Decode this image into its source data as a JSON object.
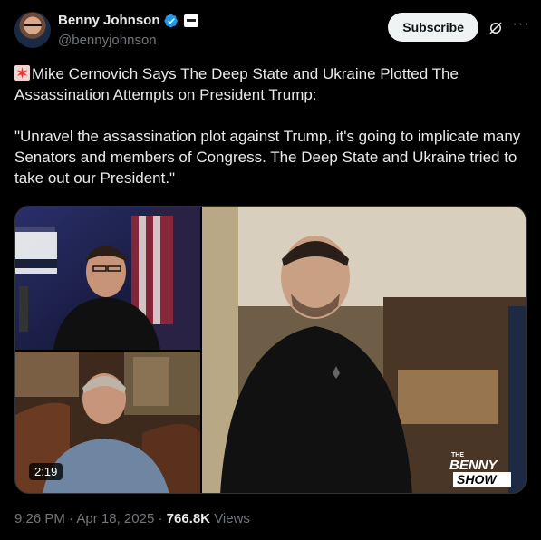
{
  "author": {
    "name": "Benny Johnson",
    "handle": "@bennyjohnson",
    "verified_color": "#1d9bf0"
  },
  "header": {
    "subscribe_label": "Subscribe",
    "grok_icon": "grok-icon",
    "more_icon": "more-icon"
  },
  "post": {
    "emoji": "siren-emoji",
    "line1": "Mike Cernovich Says The Deep State and Ukraine Plotted The Assassination Attempts on President Trump:",
    "line2": "\"Unravel the assassination plot against Trump, it's going to implicate many Senators and members of Congress. The Deep State and Ukraine tried to take out our President.\""
  },
  "media": {
    "duration": "2:19",
    "logo_text_top": "THE",
    "logo_text_mid": "BENNY",
    "logo_text_bottom": "SHOW"
  },
  "meta": {
    "time": "9:26 PM",
    "sep1": "·",
    "date": "Apr 18, 2025",
    "sep2": "·",
    "views_count": "766.8K",
    "views_label": "Views"
  }
}
